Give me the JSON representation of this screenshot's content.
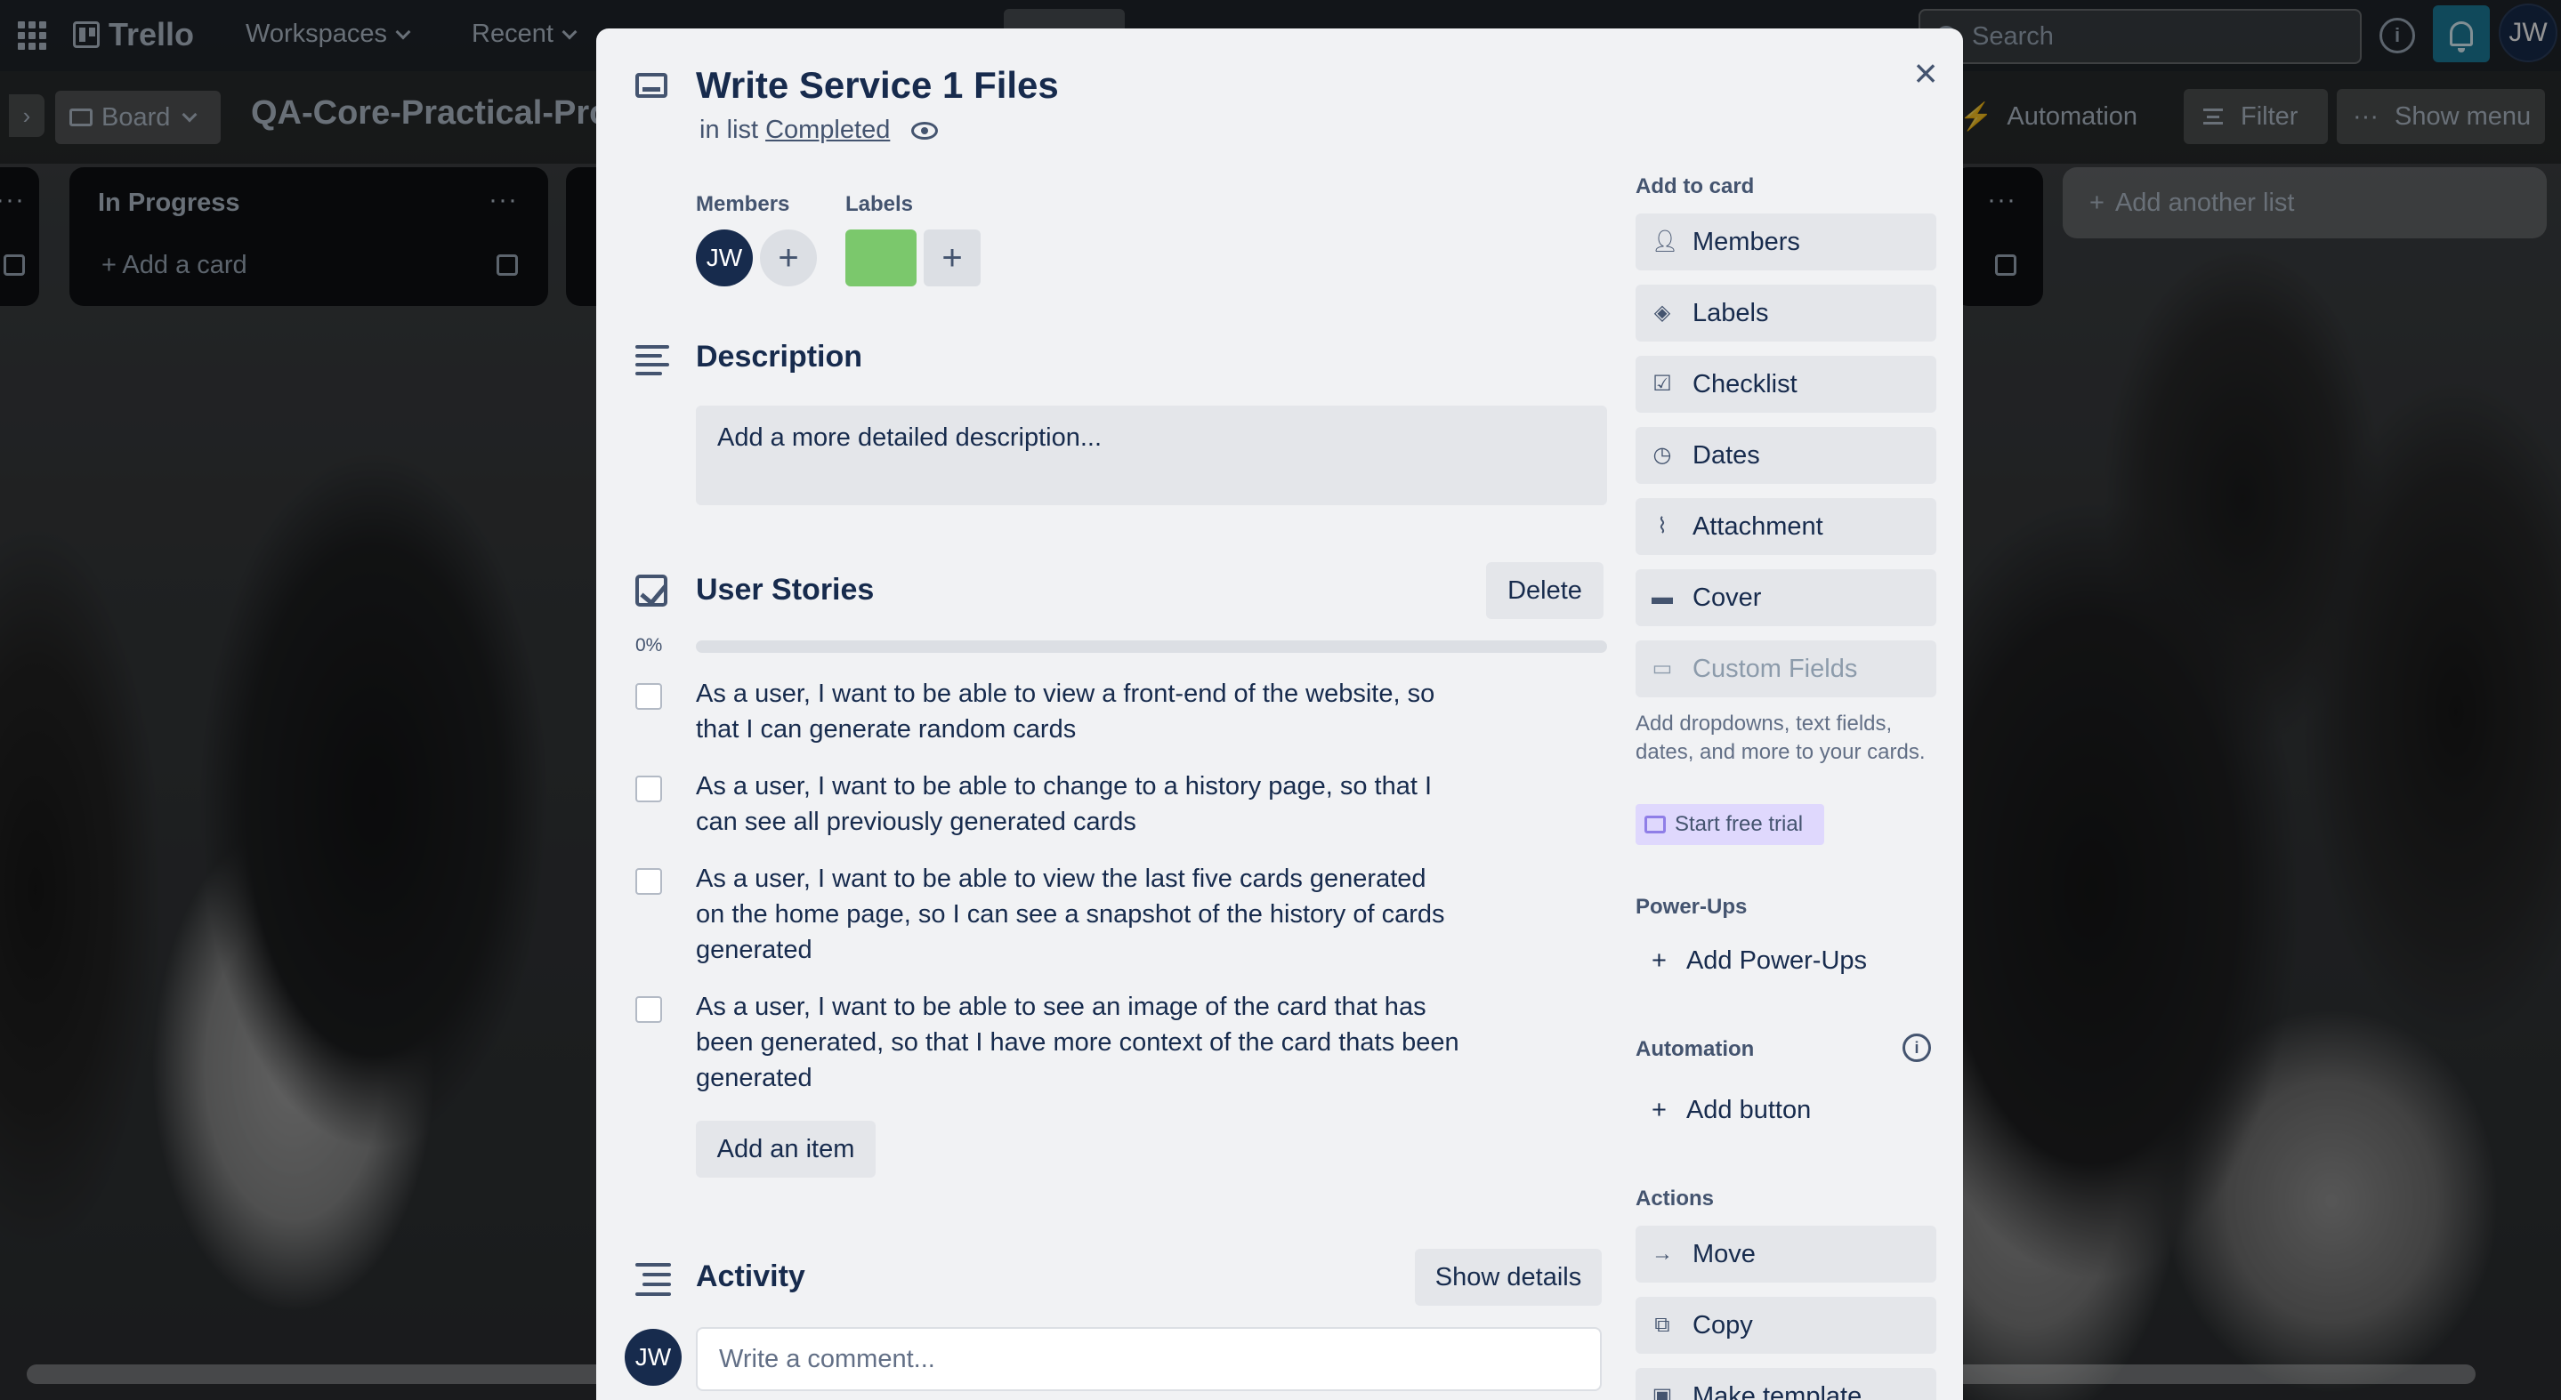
{
  "topnav": {
    "app_name": "Trello",
    "workspaces_label": "Workspaces",
    "recent_label": "Recent",
    "search_placeholder": "Search",
    "user_initials": "JW"
  },
  "boardbar": {
    "view_label": "Board",
    "board_title": "QA-Core-Practical-Pro",
    "automation_label": "Automation",
    "filter_label": "Filter",
    "show_menu_label": "Show menu"
  },
  "lists": [
    {
      "title": "In Progress",
      "add_card_label": "Add a card"
    }
  ],
  "add_list_label": "Add another list",
  "card": {
    "title": "Write Service 1 Files",
    "in_list_prefix": "in list",
    "list_name": "Completed",
    "members_label": "Members",
    "labels_label": "Labels",
    "member_initials": "JW",
    "label_color": "#7bc86c",
    "description_title": "Description",
    "description_placeholder": "Add a more detailed description...",
    "checklist": {
      "title": "User Stories",
      "delete_label": "Delete",
      "progress_text": "0%",
      "progress": 0,
      "items": [
        {
          "text": "As a user, I want to be able to view a front-end of the website, so that I can generate random cards",
          "checked": false
        },
        {
          "text": "As a user, I want to be able to change to a history page, so that I can see all previously generated cards",
          "checked": false
        },
        {
          "text": "As a user, I want to be able to view the last five cards generated on the home page, so I can see a snapshot of the history of cards generated",
          "checked": false
        },
        {
          "text": "As a user, I want to be able to see an image of the card that has been generated, so that I have more context of the card thats been generated",
          "checked": false
        }
      ],
      "add_item_label": "Add an item"
    },
    "activity_title": "Activity",
    "show_details_label": "Show details",
    "comment_placeholder": "Write a comment..."
  },
  "sidebar": {
    "add_to_card_label": "Add to card",
    "add_to_card": [
      {
        "label": "Members",
        "icon": "person-icon"
      },
      {
        "label": "Labels",
        "icon": "tag-icon"
      },
      {
        "label": "Checklist",
        "icon": "checkbox-icon"
      },
      {
        "label": "Dates",
        "icon": "clock-icon"
      },
      {
        "label": "Attachment",
        "icon": "paperclip-icon"
      },
      {
        "label": "Cover",
        "icon": "card-cover-icon"
      },
      {
        "label": "Custom Fields",
        "icon": "custom-fields-icon"
      }
    ],
    "custom_fields_help": "Add dropdowns, text fields, dates, and more to your cards.",
    "start_trial_label": "Start free trial",
    "powerups_label": "Power-Ups",
    "add_powerups_label": "Add Power-Ups",
    "automation_label": "Automation",
    "add_button_label": "Add button",
    "actions_label": "Actions",
    "actions": [
      {
        "label": "Move",
        "icon": "arrow-right-icon"
      },
      {
        "label": "Copy",
        "icon": "copy-icon"
      },
      {
        "label": "Make template",
        "icon": "template-icon"
      }
    ]
  },
  "colors": {
    "accent_blue": "#1d7f9e",
    "label_green": "#7bc86c",
    "progress_green": "#61bd4f"
  }
}
